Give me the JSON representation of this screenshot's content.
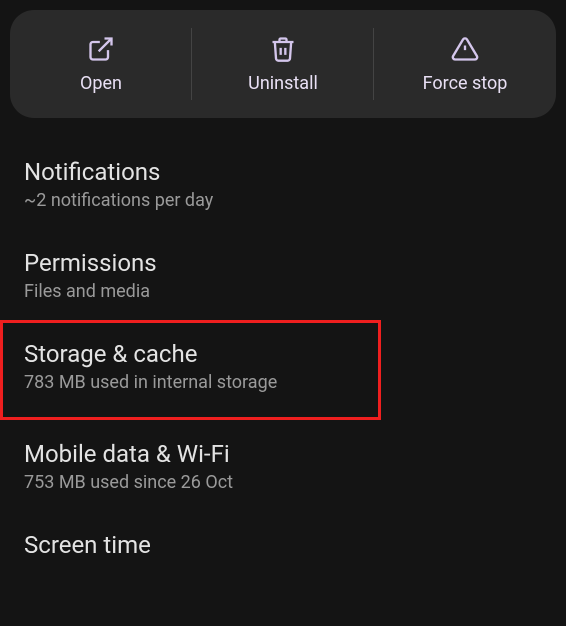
{
  "actions": {
    "open_label": "Open",
    "uninstall_label": "Uninstall",
    "force_stop_label": "Force stop"
  },
  "settings": {
    "notifications": {
      "title": "Notifications",
      "subtitle": "~2 notifications per day"
    },
    "permissions": {
      "title": "Permissions",
      "subtitle": "Files and media"
    },
    "storage": {
      "title": "Storage & cache",
      "subtitle": "783 MB used in internal storage"
    },
    "data": {
      "title": "Mobile data & Wi-Fi",
      "subtitle": "753 MB used since 26 Oct"
    },
    "screen_time": {
      "title": "Screen time"
    }
  }
}
